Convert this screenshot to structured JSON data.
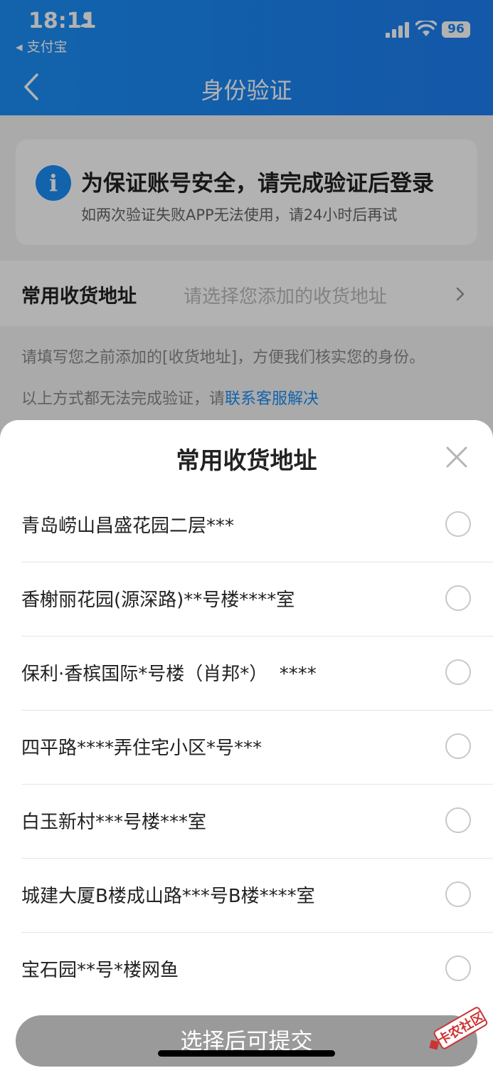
{
  "status": {
    "time": "18:11",
    "back_app": "◂ 支付宝",
    "battery": "96"
  },
  "nav": {
    "title": "身份验证"
  },
  "notice": {
    "icon": "info-icon",
    "icon_glyph": "i",
    "title": "为保证账号安全，请完成验证后登录",
    "subtitle": "如两次验证失败APP无法使用，请24小时后再试"
  },
  "address_field": {
    "label": "常用收货地址",
    "placeholder": "请选择您添加的收货地址"
  },
  "hints": {
    "line1": "请填写您之前添加的[收货地址]，方便我们核实您的身份。",
    "line2_prefix": "以上方式都无法完成验证，请",
    "line2_link": "联系客服解决"
  },
  "sheet": {
    "title": "常用收货地址",
    "options": [
      "青岛崂山昌盛花园二层***",
      "香榭丽花园(源深路)**号楼****室",
      "保利·香槟国际*号楼（肖邦*）  ****",
      "四平路****弄住宅小区*号***",
      "白玉新村***号楼***室",
      "城建大厦B楼成山路***号B楼****室",
      "宝石园**号*楼网鱼"
    ],
    "submit_label": "选择后可提交"
  },
  "watermark": {
    "text": "卡农社区"
  },
  "colors": {
    "brand_blue": "#1a8ff7",
    "submit_disabled": "#9a9a9a"
  }
}
